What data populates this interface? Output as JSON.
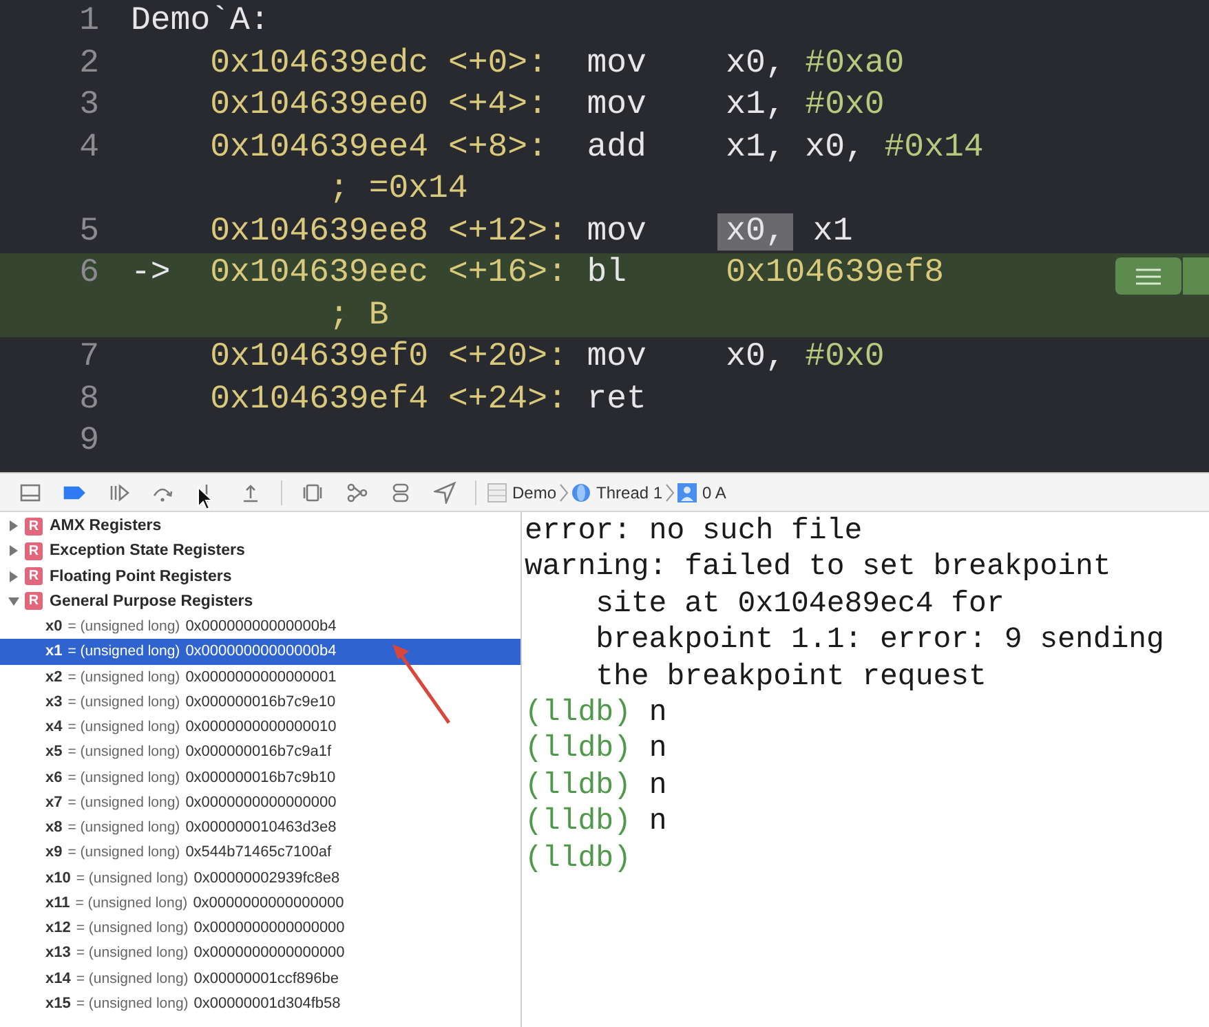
{
  "editor": {
    "lines": [
      {
        "number": "1",
        "kind": "label",
        "text": "Demo`A:",
        "current": false
      },
      {
        "number": "2",
        "kind": "instruction",
        "address": "0x104639edc",
        "offset": "<+0>:",
        "mnemonic": "mov",
        "operands": [
          {
            "text": "x0,",
            "kind": "register",
            "highlighted": false
          },
          {
            "text": "#0xa0",
            "kind": "immediate",
            "highlighted": false
          }
        ],
        "current": false
      },
      {
        "number": "3",
        "kind": "instruction",
        "address": "0x104639ee0",
        "offset": "<+4>:",
        "mnemonic": "mov",
        "operands": [
          {
            "text": "x1,",
            "kind": "register",
            "highlighted": false
          },
          {
            "text": "#0x0",
            "kind": "immediate",
            "highlighted": false
          }
        ],
        "current": false
      },
      {
        "number": "4",
        "kind": "instruction",
        "address": "0x104639ee4",
        "offset": "<+8>:",
        "mnemonic": "add",
        "operands": [
          {
            "text": "x1,",
            "kind": "register",
            "highlighted": false
          },
          {
            "text": "x0,",
            "kind": "register",
            "highlighted": false
          },
          {
            "text": "#0x14",
            "kind": "immediate",
            "highlighted": false
          }
        ],
        "comment": "; =0x14",
        "current": false
      },
      {
        "number": "5",
        "kind": "instruction",
        "address": "0x104639ee8",
        "offset": "<+12>:",
        "mnemonic": "mov",
        "operands": [
          {
            "text": "x0,",
            "kind": "register",
            "highlighted": true
          },
          {
            "text": "x1",
            "kind": "register",
            "highlighted": false
          }
        ],
        "current": false
      },
      {
        "number": "6",
        "kind": "instruction",
        "marker": "->",
        "address": "0x104639eec",
        "offset": "<+16>:",
        "mnemonic": "bl",
        "operands": [
          {
            "text": "0x104639ef8",
            "kind": "address",
            "highlighted": false
          }
        ],
        "comment": "; B",
        "current": true
      },
      {
        "number": "7",
        "kind": "instruction",
        "address": "0x104639ef0",
        "offset": "<+20>:",
        "mnemonic": "mov",
        "operands": [
          {
            "text": "x0,",
            "kind": "register",
            "highlighted": false
          },
          {
            "text": "#0x0",
            "kind": "immediate",
            "highlighted": false
          }
        ],
        "current": false
      },
      {
        "number": "8",
        "kind": "instruction",
        "address": "0x104639ef4",
        "offset": "<+24>:",
        "mnemonic": "ret",
        "current": false
      },
      {
        "number": "9",
        "kind": "empty",
        "current": false
      }
    ]
  },
  "toolbar": {
    "breakpoints_active": true,
    "breadcrumb": [
      {
        "kind": "process",
        "label": "Demo"
      },
      {
        "kind": "thread",
        "label": "Thread 1"
      },
      {
        "kind": "frame",
        "label": "0 A"
      }
    ]
  },
  "variables": {
    "groups": [
      {
        "badge": "R",
        "name": "AMX Registers",
        "expanded": false
      },
      {
        "badge": "R",
        "name": "Exception State Registers",
        "expanded": false
      },
      {
        "badge": "R",
        "name": "Floating Point Registers",
        "expanded": false
      },
      {
        "badge": "R",
        "name": "General Purpose Registers",
        "expanded": true,
        "children": [
          {
            "name": "x0",
            "type": "= (unsigned long)",
            "value": "0x00000000000000b4",
            "selected": false
          },
          {
            "name": "x1",
            "type": "= (unsigned long)",
            "value": "0x00000000000000b4",
            "selected": true
          },
          {
            "name": "x2",
            "type": "= (unsigned long)",
            "value": "0x0000000000000001",
            "selected": false
          },
          {
            "name": "x3",
            "type": "= (unsigned long)",
            "value": "0x000000016b7c9e10",
            "selected": false
          },
          {
            "name": "x4",
            "type": "= (unsigned long)",
            "value": "0x0000000000000010",
            "selected": false
          },
          {
            "name": "x5",
            "type": "= (unsigned long)",
            "value": "0x000000016b7c9a1f",
            "selected": false
          },
          {
            "name": "x6",
            "type": "= (unsigned long)",
            "value": "0x000000016b7c9b10",
            "selected": false
          },
          {
            "name": "x7",
            "type": "= (unsigned long)",
            "value": "0x0000000000000000",
            "selected": false
          },
          {
            "name": "x8",
            "type": "= (unsigned long)",
            "value": "0x000000010463d3e8",
            "selected": false
          },
          {
            "name": "x9",
            "type": "= (unsigned long)",
            "value": "0x544b71465c7100af",
            "selected": false
          },
          {
            "name": "x10",
            "type": "= (unsigned long)",
            "value": "0x00000002939fc8e8",
            "selected": false
          },
          {
            "name": "x11",
            "type": "= (unsigned long)",
            "value": "0x0000000000000000",
            "selected": false
          },
          {
            "name": "x12",
            "type": "= (unsigned long)",
            "value": "0x0000000000000000",
            "selected": false
          },
          {
            "name": "x13",
            "type": "= (unsigned long)",
            "value": "0x0000000000000000",
            "selected": false
          },
          {
            "name": "x14",
            "type": "= (unsigned long)",
            "value": "0x00000001ccf896be",
            "selected": false
          },
          {
            "name": "x15",
            "type": "= (unsigned long)",
            "value": "0x00000001d304fb58",
            "selected": false
          }
        ]
      }
    ]
  },
  "console": {
    "lines": [
      {
        "kind": "output",
        "text": "error: no such file"
      },
      {
        "kind": "output",
        "text": "warning: failed to set breakpoint"
      },
      {
        "kind": "continuation",
        "text": "site at 0x104e89ec4 for"
      },
      {
        "kind": "continuation",
        "text": "breakpoint 1.1: error: 9 sending"
      },
      {
        "kind": "continuation",
        "text": "the breakpoint request"
      },
      {
        "kind": "prompt",
        "prompt": "(lldb)",
        "command": "n"
      },
      {
        "kind": "prompt",
        "prompt": "(lldb)",
        "command": "n"
      },
      {
        "kind": "prompt",
        "prompt": "(lldb)",
        "command": "n"
      },
      {
        "kind": "prompt",
        "prompt": "(lldb)",
        "command": "n"
      },
      {
        "kind": "prompt",
        "prompt": "(lldb)"
      }
    ]
  }
}
